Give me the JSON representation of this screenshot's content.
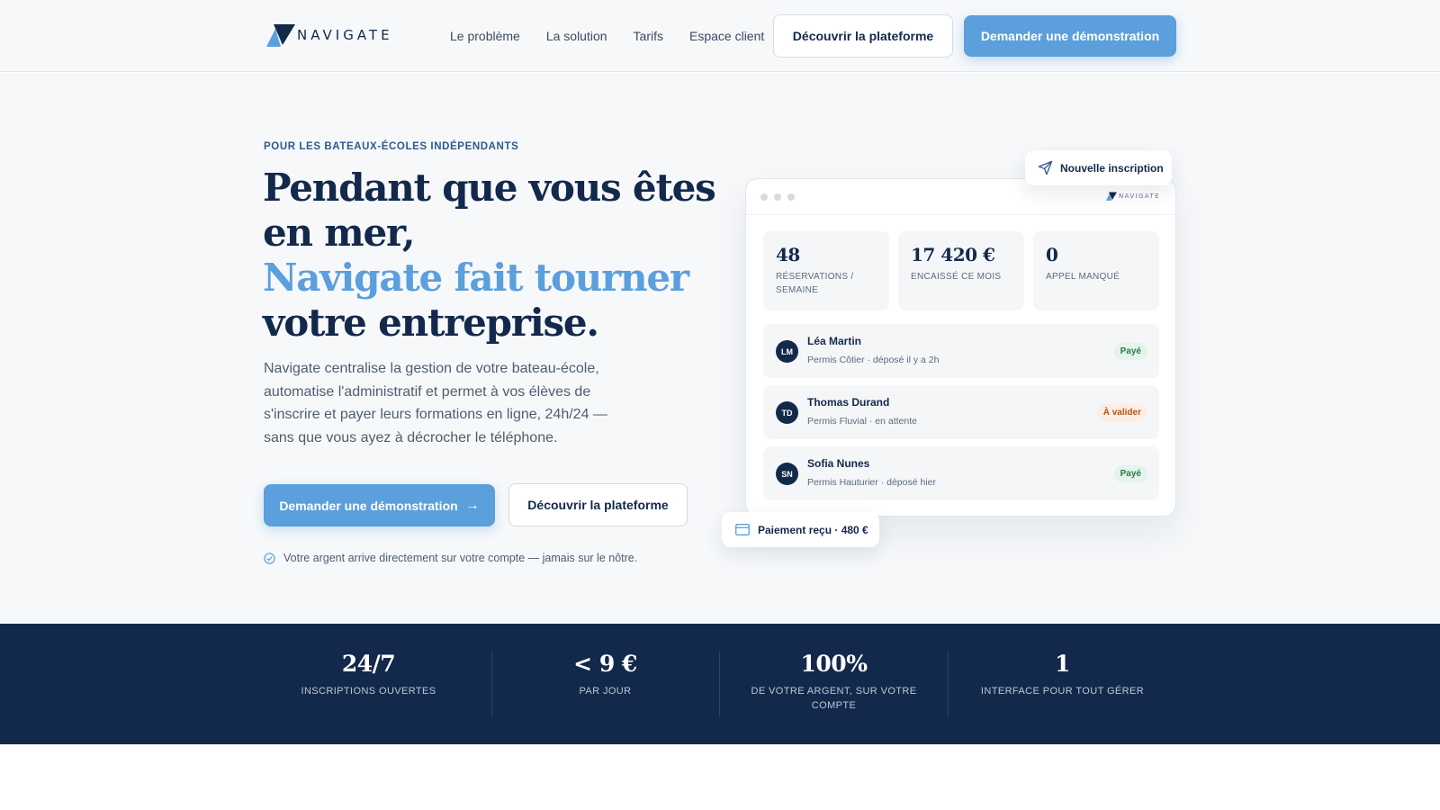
{
  "header": {
    "brand": "NAVIGATE",
    "nav": [
      "Le problème",
      "La solution",
      "Tarifs",
      "Espace client"
    ],
    "cta_secondary": "Découvrir la plateforme",
    "cta_primary": "Demander une démonstration"
  },
  "hero": {
    "eyebrow": "POUR LES BATEAUX-ÉCOLES INDÉPENDANTS",
    "headline_line1": "Pendant que vous êtes",
    "headline_line2": "en mer,",
    "headline_accent": "Navigate fait tourner",
    "headline_line4": "votre entreprise.",
    "lead": "Navigate centralise la gestion de votre bateau-école, automatise l'administratif et permet à vos élèves de s'inscrire et payer leurs formations en ligne, 24h/24 — sans que vous ayez à décrocher le téléphone.",
    "cta_primary": "Demander une démonstration",
    "cta_primary_arrow": "→",
    "cta_secondary": "Découvrir la plateforme",
    "reassurance": "Votre argent arrive directement sur votre compte — jamais sur le nôtre."
  },
  "mockup": {
    "brand": "NAVIGATE",
    "notification": "Nouvelle inscription",
    "payment_toast": "Paiement reçu · 480 €",
    "stats": [
      {
        "value": "48",
        "label": "RÉSERVATIONS / SEMAINE"
      },
      {
        "value": "17 420 €",
        "label": "ENCAISSÉ CE MOIS"
      },
      {
        "value": "0",
        "label": "APPEL MANQUÉ"
      }
    ],
    "rows": [
      {
        "initials": "LM",
        "name": "Léa Martin",
        "detail": "Permis Côtier · déposé il y a 2h",
        "status": "Payé"
      },
      {
        "initials": "TD",
        "name": "Thomas Durand",
        "detail": "Permis Fluvial · en attente",
        "status": "À valider"
      },
      {
        "initials": "SN",
        "name": "Sofia Nunes",
        "detail": "Permis Hauturier · déposé hier",
        "status": "Payé"
      }
    ]
  },
  "band": [
    {
      "value": "24/7",
      "label": "INSCRIPTIONS OUVERTES"
    },
    {
      "value": "< 9 €",
      "label": "PAR JOUR"
    },
    {
      "value": "100%",
      "label": "DE VOTRE ARGENT, SUR VOTRE COMPTE"
    },
    {
      "value": "1",
      "label": "INTERFACE POUR TOUT GÉRER"
    }
  ],
  "colors": {
    "navy": "#13294b",
    "accent": "#5b9fdc",
    "background": "#f6f8fa",
    "paid_badge": "#e3f4ea",
    "pending_badge": "#fdeee3"
  },
  "icons": {
    "logo": "navigate-logo-icon",
    "notification": "send-icon",
    "payment": "credit-card-icon",
    "reassurance": "check-circle-icon"
  }
}
